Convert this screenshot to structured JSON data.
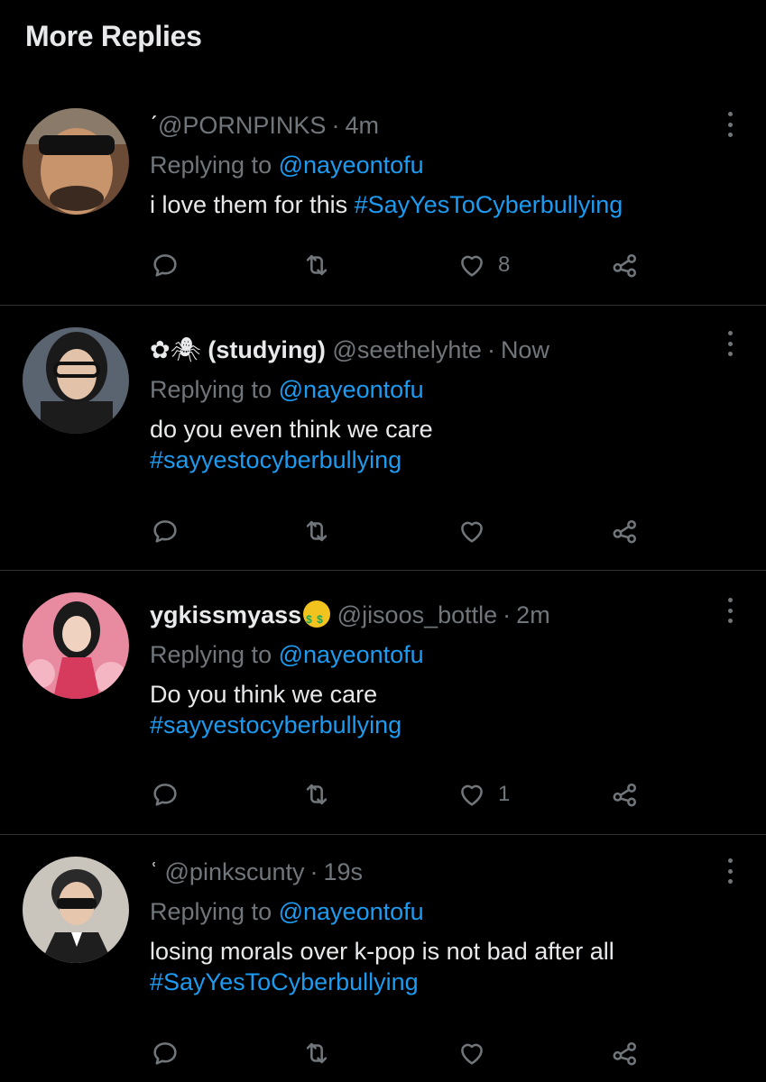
{
  "section_title": "More Replies",
  "colors": {
    "background": "#000000",
    "text": "#e7e9ea",
    "muted": "#71767b",
    "accent": "#1d9bf0",
    "divider": "#2f3336"
  },
  "icons": {
    "reply": "reply-icon",
    "retweet": "retweet-icon",
    "like": "heart-icon",
    "share": "share-icon",
    "more": "more-options-icon"
  },
  "replies": [
    {
      "prefix": "ˊ",
      "display_name": "",
      "handle": "@PORNPINKS",
      "time": "4m",
      "replying_label": "Replying to",
      "replying_to": "@nayeontofu",
      "text": "i love them for this",
      "hashtag": "#SayYesToCyberbullying",
      "likes": "8"
    },
    {
      "prefix": "✿🕷",
      "display_name": "(studying)",
      "handle": "@seethelyhte",
      "time": "Now",
      "replying_label": "Replying to",
      "replying_to": "@nayeontofu",
      "text": "do you even think we care",
      "hashtag": "#sayyestocyberbullying",
      "likes": ""
    },
    {
      "prefix": "",
      "display_name": "ygkissmyass",
      "emoji": "money-mouth-face",
      "handle": "@jisoos_bottle",
      "time": "2m",
      "replying_label": "Replying to",
      "replying_to": "@nayeontofu",
      "text": "Do you think we care",
      "hashtag": "#sayyestocyberbullying",
      "likes": "1"
    },
    {
      "prefix": "ʿ",
      "display_name": "",
      "handle": "@pinkscunty",
      "time": "19s",
      "replying_label": "Replying to",
      "replying_to": "@nayeontofu",
      "text": "losing morals over k-pop is not bad after all",
      "hashtag": "#SayYesToCyberbullying",
      "likes": ""
    }
  ]
}
